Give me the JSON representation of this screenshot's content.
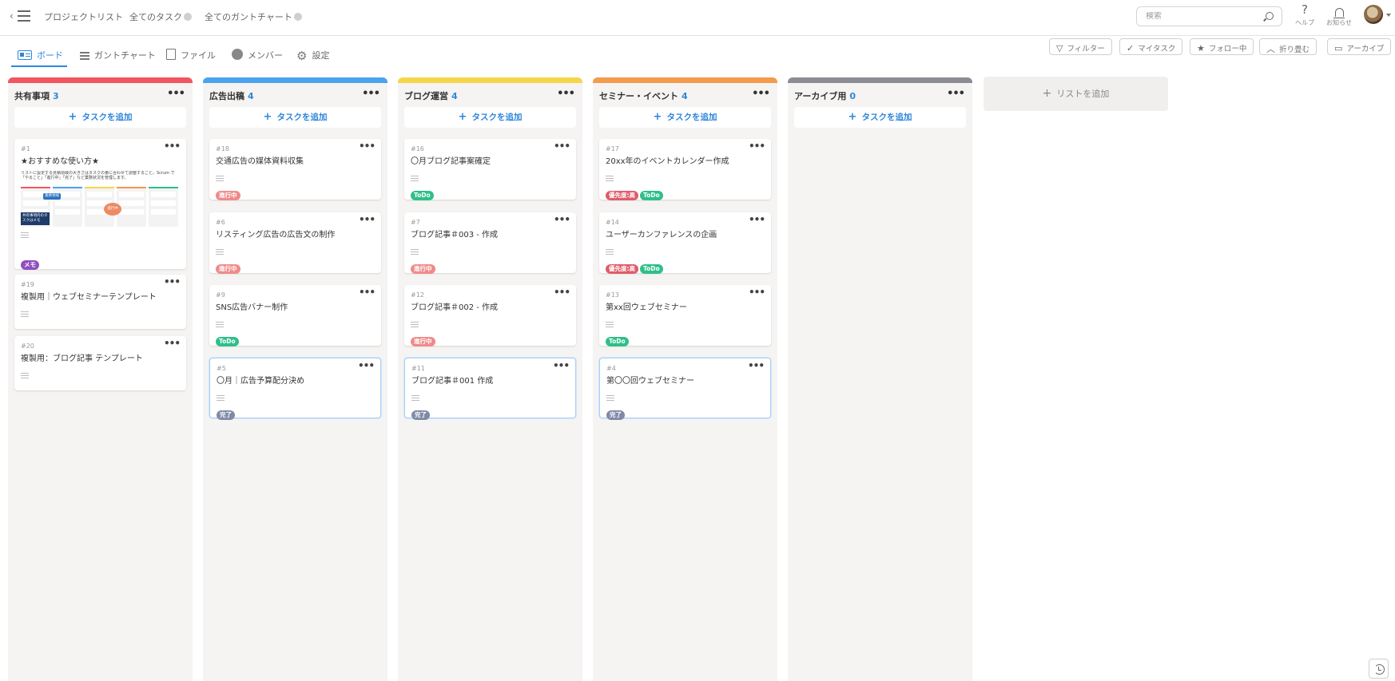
{
  "nav": {
    "project_list": "プロジェクトリスト",
    "all_tasks": "全てのタスク",
    "all_gantt": "全てのガントチャート"
  },
  "search": {
    "placeholder": "検索"
  },
  "util": {
    "help_glyph": "?",
    "help": "ヘルプ",
    "notify": "お知らせ"
  },
  "tabs": [
    {
      "label": "ボード",
      "active": true
    },
    {
      "label": "ガントチャート"
    },
    {
      "label": "ファイル"
    },
    {
      "label": "メンバー"
    },
    {
      "label": "設定"
    }
  ],
  "filters": {
    "filter": "フィルター",
    "mytask": "マイタスク",
    "following": "フォロー中",
    "collapse": "折り畳む",
    "archive": "アーカイブ"
  },
  "add_task_label": "タスクを追加",
  "add_list_label": "リストを追加",
  "more_glyph": "•••",
  "columns": [
    {
      "name": "共有事項",
      "count": "3",
      "color": "#f2555f",
      "cards": [
        {
          "num": "#1",
          "title": "★おすすめな使い方★",
          "thumb_text": "リストに設定する見積領域の大きさはタスクの量に合わせて調整すること。Scrum で「やること」「進行中」「完了」など業務状況を管理します。",
          "thumb_label1": "業務領域",
          "thumb_label2": "進行中",
          "thumb_label3": "共有事項内のタスクはメモ",
          "tags": [
            "メモ"
          ]
        },
        {
          "num": "#19",
          "title": "複製用｜ウェブセミナーテンプレート",
          "tags": []
        },
        {
          "num": "#20",
          "title": "複製用：ブログ記事 テンプレート",
          "tags": []
        }
      ]
    },
    {
      "name": "広告出稿",
      "count": "4",
      "color": "#4aa3ec",
      "cards": [
        {
          "num": "#18",
          "title": "交通広告の媒体資料収集",
          "tags": [
            "進行中"
          ]
        },
        {
          "num": "#6",
          "title": "リスティング広告の広告文の制作",
          "tags": [
            "進行中"
          ]
        },
        {
          "num": "#9",
          "title": "SNS広告バナー制作",
          "tags": [
            "ToDo"
          ]
        },
        {
          "num": "#5",
          "title": "〇月｜広告予算配分決め",
          "tags": [
            "完了"
          ]
        }
      ]
    },
    {
      "name": "ブログ運営",
      "count": "4",
      "color": "#f5d64a",
      "cards": [
        {
          "num": "#16",
          "title": "〇月ブログ記事案確定",
          "tags": [
            "ToDo"
          ]
        },
        {
          "num": "#7",
          "title": "ブログ記事＃003 - 作成",
          "tags": [
            "進行中"
          ]
        },
        {
          "num": "#12",
          "title": "ブログ記事＃002 - 作成",
          "tags": [
            "進行中"
          ]
        },
        {
          "num": "#11",
          "title": "ブログ記事＃001 作成",
          "tags": [
            "完了"
          ]
        }
      ]
    },
    {
      "name": "セミナー・イベント",
      "count": "4",
      "color": "#f39a4c",
      "cards": [
        {
          "num": "#17",
          "title": "20xx年のイベントカレンダー作成",
          "tags": [
            "優先度:高",
            "ToDo"
          ]
        },
        {
          "num": "#14",
          "title": "ユーザーカンファレンスの企画",
          "tags": [
            "優先度:高",
            "ToDo"
          ]
        },
        {
          "num": "#13",
          "title": "第xx回ウェブセミナー",
          "tags": [
            "ToDo"
          ]
        },
        {
          "num": "#4",
          "title": "第〇〇回ウェブセミナー",
          "tags": [
            "完了"
          ]
        }
      ]
    },
    {
      "name": "アーカイブ用",
      "count": "0",
      "color": "#8c8c94",
      "cards": []
    }
  ]
}
